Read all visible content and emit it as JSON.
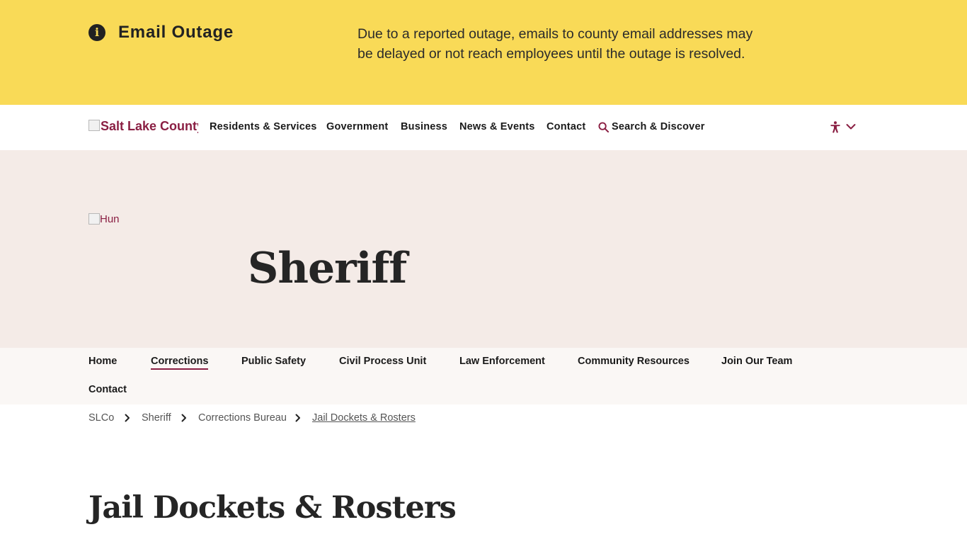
{
  "alert": {
    "icon": "info-icon",
    "icon_glyph": "i",
    "title": "Email Outage",
    "message": "Due to a reported outage, emails to county email addresses may be delayed or not reach employees until the outage is resolved."
  },
  "header": {
    "logo_alt": "Salt Lake County",
    "nav": [
      {
        "label": "Residents & Services"
      },
      {
        "label": "Government"
      },
      {
        "label": "Business"
      },
      {
        "label": "News & Events"
      },
      {
        "label": "Contact"
      }
    ],
    "search_label": "Search & Discover",
    "search_icon": "search-icon",
    "accessibility_icon": "accessibility-icon",
    "menu_icon": "chevron-down-icon"
  },
  "hero": {
    "image_alt": "Hun",
    "title": "Sheriff"
  },
  "subnav": {
    "items": [
      {
        "label": "Home"
      },
      {
        "label": "Corrections",
        "active": true
      },
      {
        "label": "Public Safety"
      },
      {
        "label": "Civil Process Unit"
      },
      {
        "label": "Law Enforcement"
      },
      {
        "label": "Community Resources"
      },
      {
        "label": "Join Our Team"
      },
      {
        "label": "Contact"
      }
    ]
  },
  "breadcrumb": {
    "items": [
      {
        "label": "SLCo"
      },
      {
        "label": "Sheriff"
      },
      {
        "label": "Corrections Bureau"
      },
      {
        "label": "Jail Dockets & Rosters",
        "current": true
      }
    ],
    "separator_icon": "chevron-right-icon"
  },
  "page": {
    "title": "Jail Dockets & Rosters"
  },
  "colors": {
    "alert_bg": "#f9da57",
    "brand_maroon": "#8a1f43",
    "hero_bg": "#f4ebe7",
    "subnav_bg": "#faf7f5"
  }
}
